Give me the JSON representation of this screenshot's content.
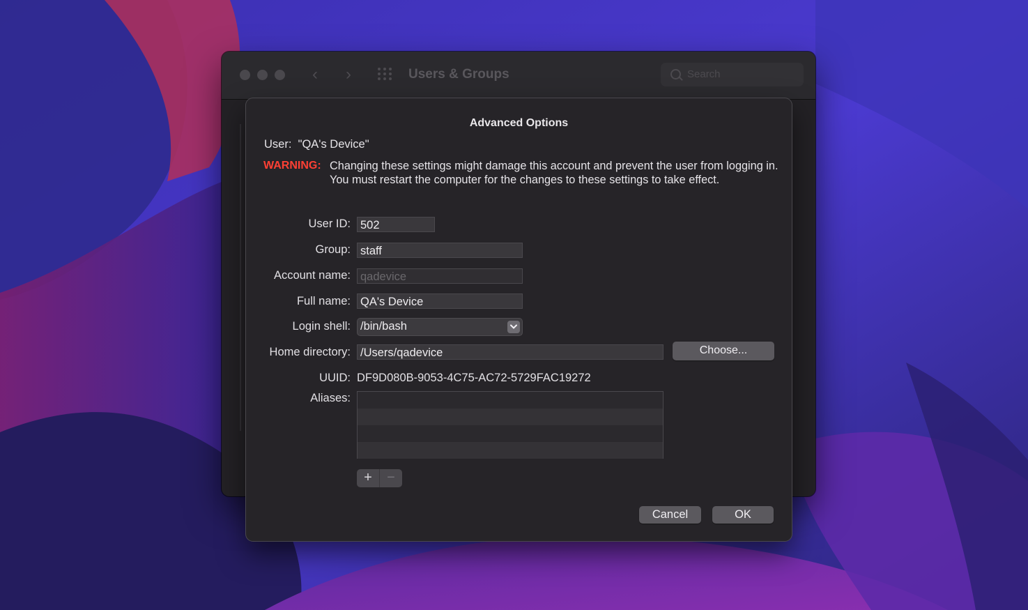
{
  "background_window": {
    "title": "Users & Groups",
    "search_placeholder": "Search"
  },
  "dialog": {
    "title": "Advanced Options",
    "user_label": "User:",
    "user_value": "\"QA's Device\"",
    "warning_label": "WARNING:",
    "warning_text": "Changing these settings might damage this account and prevent the user from logging in. You must restart the computer for the changes to these settings to take effect.",
    "fields": {
      "user_id": {
        "label": "User ID:",
        "value": "502"
      },
      "group": {
        "label": "Group:",
        "value": "staff"
      },
      "account_name": {
        "label": "Account name:",
        "value": "qadevice"
      },
      "full_name": {
        "label": "Full name:",
        "value": "QA's Device"
      },
      "login_shell": {
        "label": "Login shell:",
        "value": "/bin/bash"
      },
      "home_directory": {
        "label": "Home directory:",
        "value": "/Users/qadevice"
      },
      "uuid": {
        "label": "UUID:",
        "value": "DF9D080B-9053-4C75-AC72-5729FAC19272"
      },
      "aliases": {
        "label": "Aliases:",
        "items": []
      }
    },
    "choose_label": "Choose...",
    "add_symbol": "+",
    "remove_symbol": "−",
    "cancel_label": "Cancel",
    "ok_label": "OK"
  },
  "colors": {
    "warning": "#ff4034",
    "sheet_background": "#262428",
    "button": "#5b595e"
  }
}
